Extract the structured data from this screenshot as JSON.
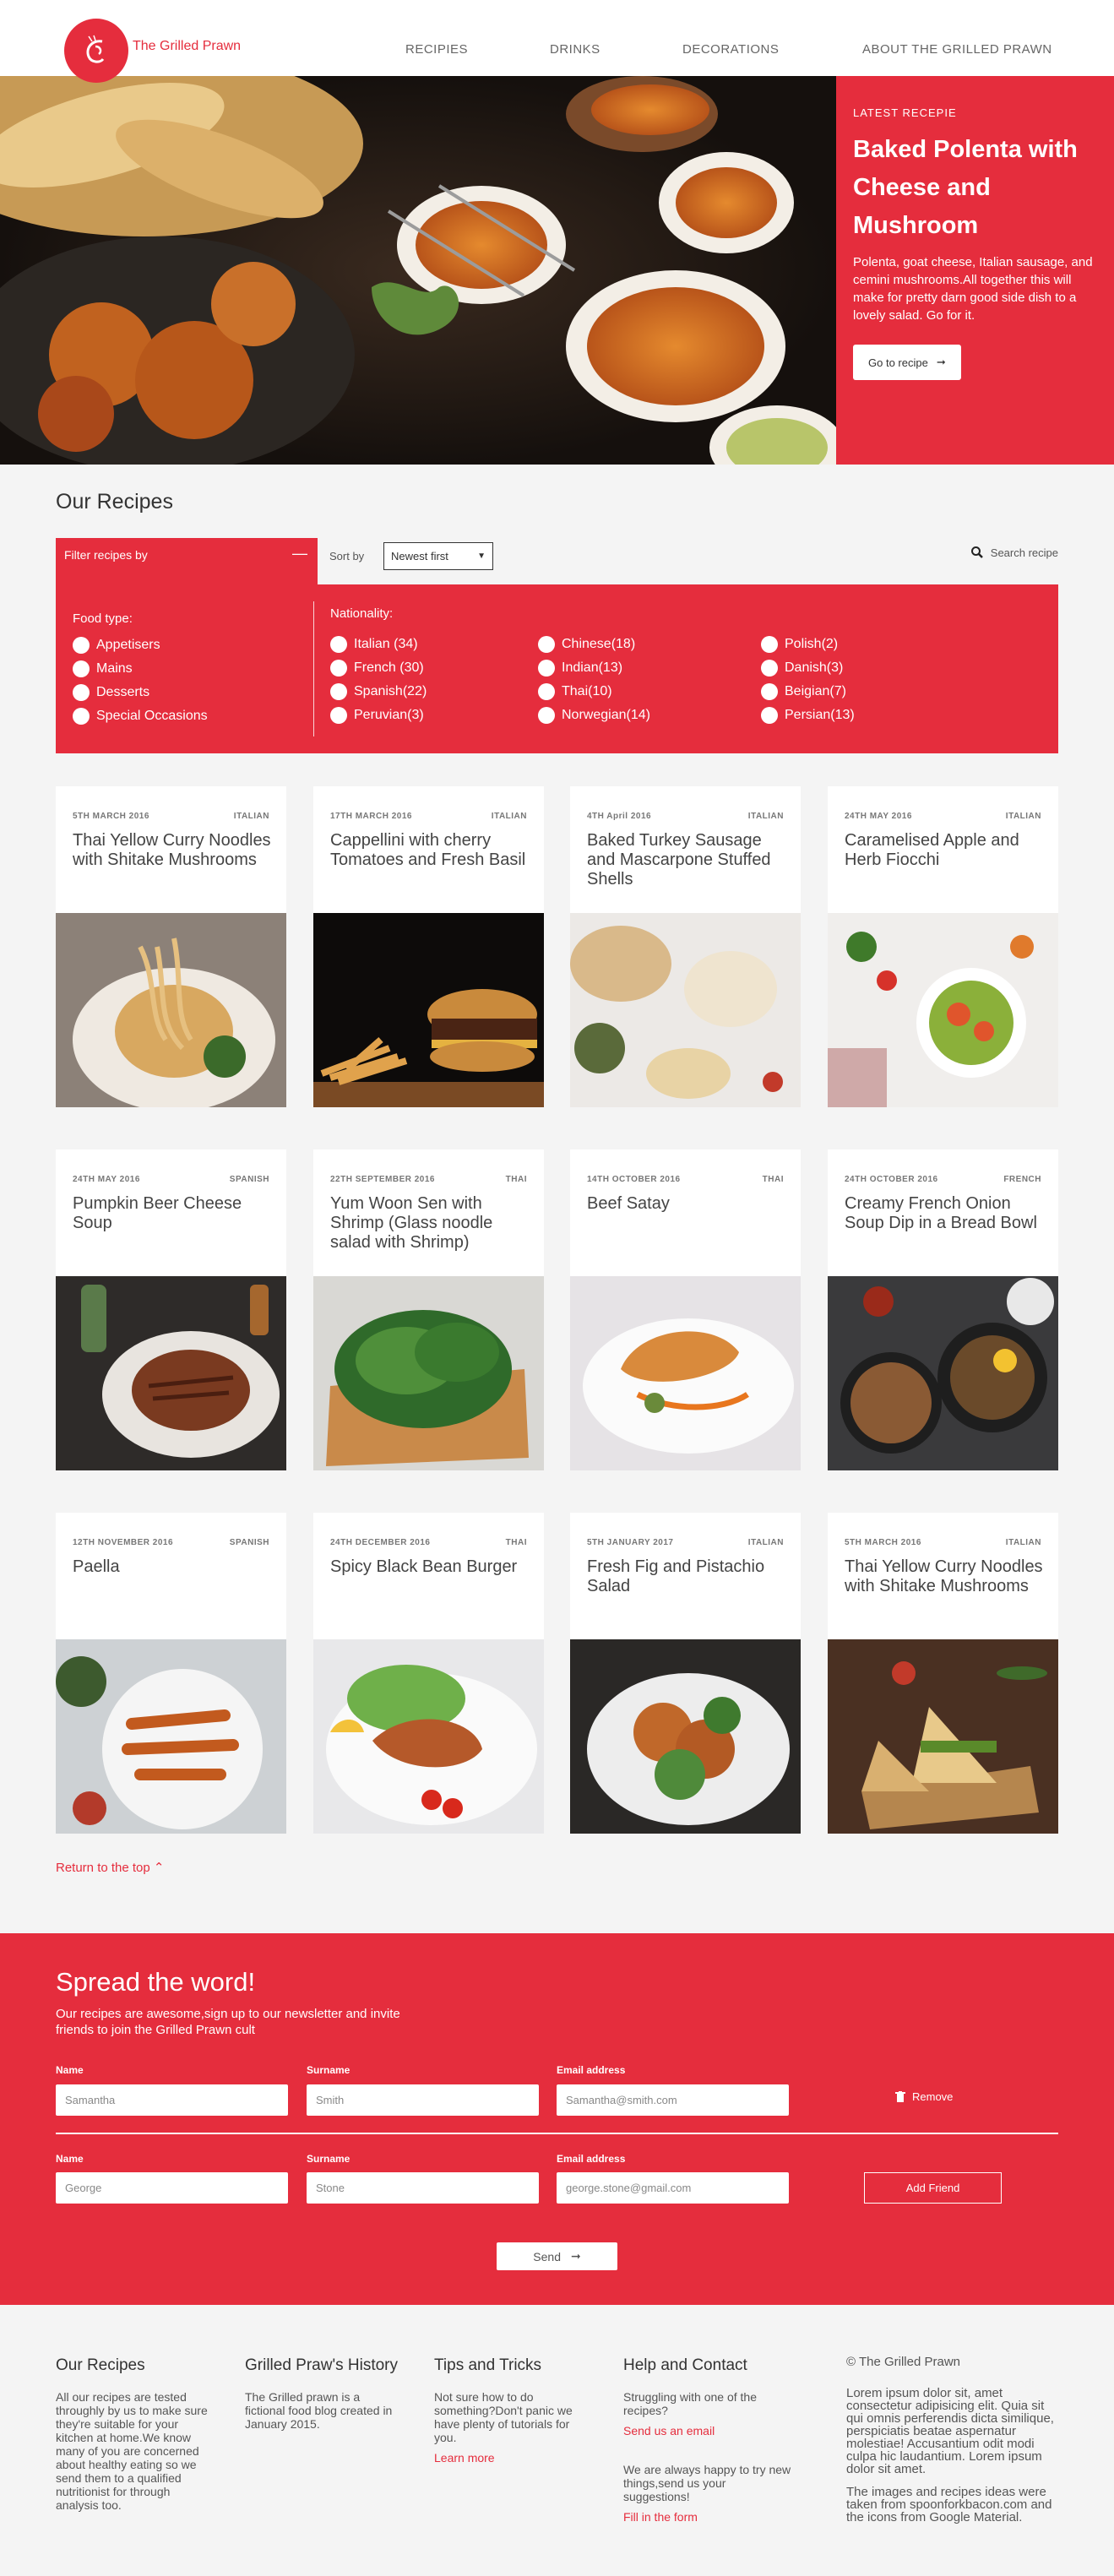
{
  "header": {
    "brand": "The Grilled Prawn",
    "nav": [
      "RECIPIES",
      "DRINKS",
      "DECORATIONS",
      "ABOUT THE GRILLED PRAWN"
    ]
  },
  "hero": {
    "kicker": "LATEST RECEPIE",
    "title": "Baked Polenta with Cheese and Mushroom",
    "description": "Polenta, goat cheese, Italian sausage, and cemini mushrooms.All together this will make for pretty darn good side dish to a lovely salad. Go for it.",
    "button": "Go to recipe"
  },
  "recipes": {
    "title": "Our Recipes",
    "filter_tab": "Filter recipes by",
    "sort_label": "Sort by",
    "sort_value": "Newest first",
    "search": "Search recipe",
    "food_type_title": "Food type:",
    "food_types": [
      "Appetisers",
      "Mains",
      "Desserts",
      "Special Occasions"
    ],
    "nationality_title": "Nationality:",
    "nationalities": [
      [
        "Italian (34)",
        "French (30)",
        "Spanish(22)",
        "Peruvian(3)"
      ],
      [
        "Chinese(18)",
        "Indian(13)",
        "Thai(10)",
        "Norwegian(14)"
      ],
      [
        "Polish(2)",
        "Danish(3)",
        "Beigian(7)",
        "Persian(13)"
      ]
    ],
    "cards": [
      {
        "date": "5TH MARCH 2016",
        "cuisine": "ITALIAN",
        "title": "Thai Yellow Curry Noodles with Shitake Mushrooms"
      },
      {
        "date": "17TH MARCH 2016",
        "cuisine": "ITALIAN",
        "title": "Cappellini with cherry Tomatoes and Fresh Basil"
      },
      {
        "date": "4TH April 2016",
        "cuisine": "ITALIAN",
        "title": "Baked Turkey Sausage and Mascarpone Stuffed Shells"
      },
      {
        "date": "24TH MAY 2016",
        "cuisine": "ITALIAN",
        "title": "Caramelised Apple and Herb Fiocchi"
      },
      {
        "date": "24TH MAY 2016",
        "cuisine": "SPANISH",
        "title": "Pumpkin Beer Cheese Soup"
      },
      {
        "date": "22TH SEPTEMBER 2016",
        "cuisine": "THAI",
        "title": "Yum Woon Sen with Shrimp (Glass noodle salad with Shrimp)"
      },
      {
        "date": "14TH OCTOBER 2016",
        "cuisine": "THAI",
        "title": "Beef Satay"
      },
      {
        "date": "24TH OCTOBER 2016",
        "cuisine": "FRENCH",
        "title": "Creamy French Onion Soup Dip in a Bread Bowl"
      },
      {
        "date": "12TH NOVEMBER 2016",
        "cuisine": "SPANISH",
        "title": "Paella"
      },
      {
        "date": "24TH DECEMBER 2016",
        "cuisine": "THAI",
        "title": "Spicy Black Bean Burger"
      },
      {
        "date": "5TH JANUARY 2017",
        "cuisine": "ITALIAN",
        "title": "Fresh Fig and Pistachio Salad"
      },
      {
        "date": "5TH MARCH 2016",
        "cuisine": "ITALIAN",
        "title": "Thai Yellow Curry Noodles with Shitake Mushrooms"
      }
    ],
    "return_top": "Return to the top"
  },
  "newsletter": {
    "title": "Spread the word!",
    "description": "Our recipes are awesome,sign up to our newsletter and invite friends to join the Grilled Prawn cult",
    "labels": {
      "name": "Name",
      "surname": "Surname",
      "email": "Email address"
    },
    "row1": {
      "name": "Samantha",
      "surname": "Smith",
      "email": "Samantha@smith.com"
    },
    "row2": {
      "name": "George",
      "surname": "Stone",
      "email": "george.stone@gmail.com"
    },
    "remove": "Remove",
    "add_friend": "Add Friend",
    "send": "Send"
  },
  "footer": {
    "col1": {
      "title": "Our Recipes",
      "text": "All our recipes are tested throughly by us to make sure they're suitable for your kitchen at home.We know many of you are concerned about healthy eating so we send them to a qualified nutritionist for through analysis too."
    },
    "col2": {
      "title": "Grilled Praw's History",
      "text": "The Grilled prawn is a fictional food blog created in January 2015."
    },
    "col3": {
      "title": "Tips and Tricks",
      "text": "Not sure how to do something?Don't panic we have plenty of tutorials for you.",
      "link": "Learn more"
    },
    "col4": {
      "title": "Help and Contact",
      "text1": "Struggling with one of the recipes?",
      "link1": "Send us an email",
      "text2": "We are always happy to try new things,send us your suggestions!",
      "link2": "Fill in the form"
    },
    "col5": {
      "copyright": "© The Grilled Prawn",
      "text1": "Lorem ipsum dolor sit, amet consectetur adipisicing elit. Quia sit qui omnis perferendis dicta similique, perspiciatis beatae aspernatur molestiae! Accusantium odit modi culpa hic laudantium. Lorem ipsum dolor sit amet.",
      "text2": "The images and recipes ideas were taken from spoonforkbacon.com and the icons from Google Material."
    }
  },
  "colors": {
    "accent": "#e52d3d",
    "background": "#f4f4f4"
  }
}
